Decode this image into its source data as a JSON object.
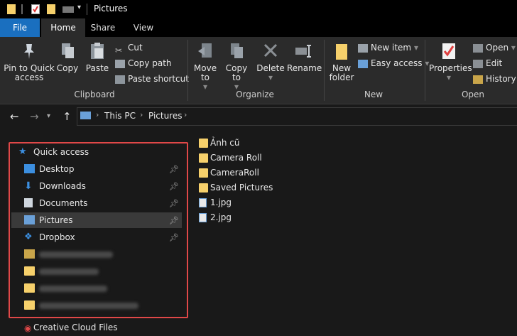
{
  "window": {
    "title": "Pictures"
  },
  "tabs": {
    "file": "File",
    "home": "Home",
    "share": "Share",
    "view": "View"
  },
  "ribbon": {
    "clipboard": {
      "label": "Clipboard",
      "pin_to_quick_access": "Pin to Quick access",
      "copy": "Copy",
      "paste": "Paste",
      "cut": "Cut",
      "copy_path": "Copy path",
      "paste_shortcut": "Paste shortcut"
    },
    "organize": {
      "label": "Organize",
      "move_to": "Move to",
      "copy_to": "Copy to",
      "delete": "Delete",
      "rename": "Rename"
    },
    "new": {
      "label": "New",
      "new_folder": "New folder",
      "new_item": "New item",
      "easy_access": "Easy access"
    },
    "open": {
      "label": "Open",
      "properties": "Properties",
      "open": "Open",
      "edit": "Edit",
      "history": "History"
    }
  },
  "address": {
    "segments": [
      "This PC",
      "Pictures"
    ]
  },
  "nav_pane": {
    "quick_access": "Quick access",
    "items": [
      {
        "label": "Desktop",
        "icon": "desktop-icon",
        "pinned": true
      },
      {
        "label": "Downloads",
        "icon": "download-icon",
        "pinned": true
      },
      {
        "label": "Documents",
        "icon": "documents-icon",
        "pinned": true
      },
      {
        "label": "Pictures",
        "icon": "pictures-icon",
        "pinned": true,
        "selected": true
      },
      {
        "label": "Dropbox",
        "icon": "dropbox-icon",
        "pinned": true
      }
    ],
    "bottom_item": "Creative Cloud Files"
  },
  "files": [
    {
      "name": "Ảnh cũ",
      "type": "folder"
    },
    {
      "name": "Camera Roll",
      "type": "folder"
    },
    {
      "name": "CameraRoll",
      "type": "folder"
    },
    {
      "name": "Saved Pictures",
      "type": "folder"
    },
    {
      "name": "1.jpg",
      "type": "jpg"
    },
    {
      "name": "2.jpg",
      "type": "jpg"
    }
  ],
  "colors": {
    "accent": "#1a6fbf",
    "highlight_box": "#e04848",
    "folder": "#f6d06b"
  }
}
